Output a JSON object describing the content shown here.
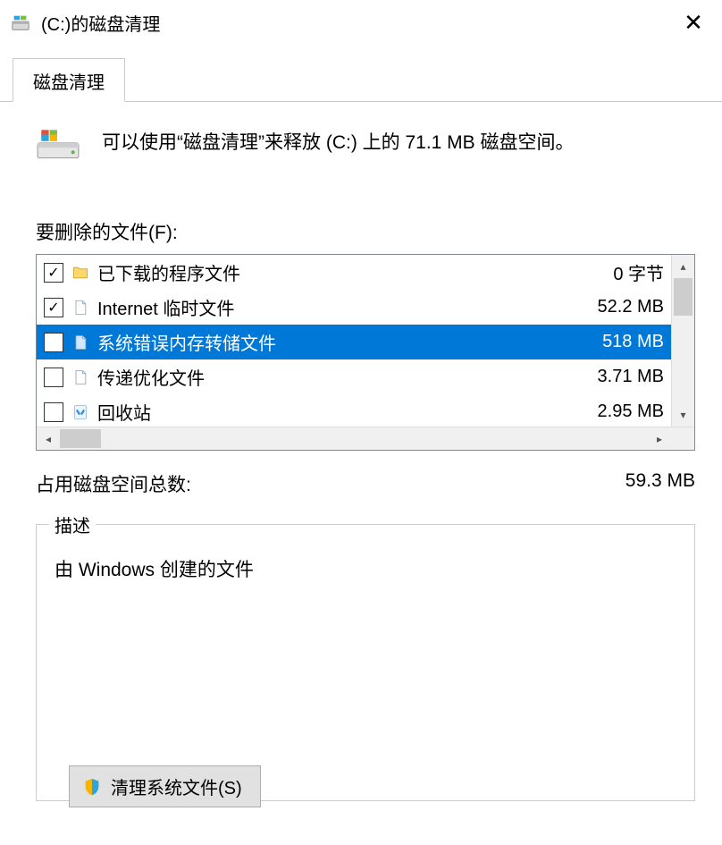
{
  "window": {
    "title": "(C:)的磁盘清理"
  },
  "tab": {
    "label": "磁盘清理"
  },
  "info": {
    "text": "可以使用“磁盘清理”来释放  (C:) 上的 71.1 MB 磁盘空间。"
  },
  "filesLabel": "要删除的文件(F):",
  "files": [
    {
      "checked": true,
      "icon": "folder",
      "name": "已下载的程序文件",
      "size": "0 字节"
    },
    {
      "checked": true,
      "icon": "page",
      "name": "Internet 临时文件",
      "size": "52.2 MB"
    },
    {
      "checked": false,
      "icon": "page",
      "name": "系统错误内存转储文件",
      "size": "518 MB",
      "selected": true
    },
    {
      "checked": false,
      "icon": "page",
      "name": "传递优化文件",
      "size": "3.71 MB"
    },
    {
      "checked": false,
      "icon": "recycle",
      "name": "回收站",
      "size": "2.95 MB"
    }
  ],
  "total": {
    "label": "占用磁盘空间总数:",
    "value": "59.3 MB"
  },
  "desc": {
    "heading": "描述",
    "text": "由 Windows 创建的文件"
  },
  "cleanSys": "清理系统文件(S)"
}
